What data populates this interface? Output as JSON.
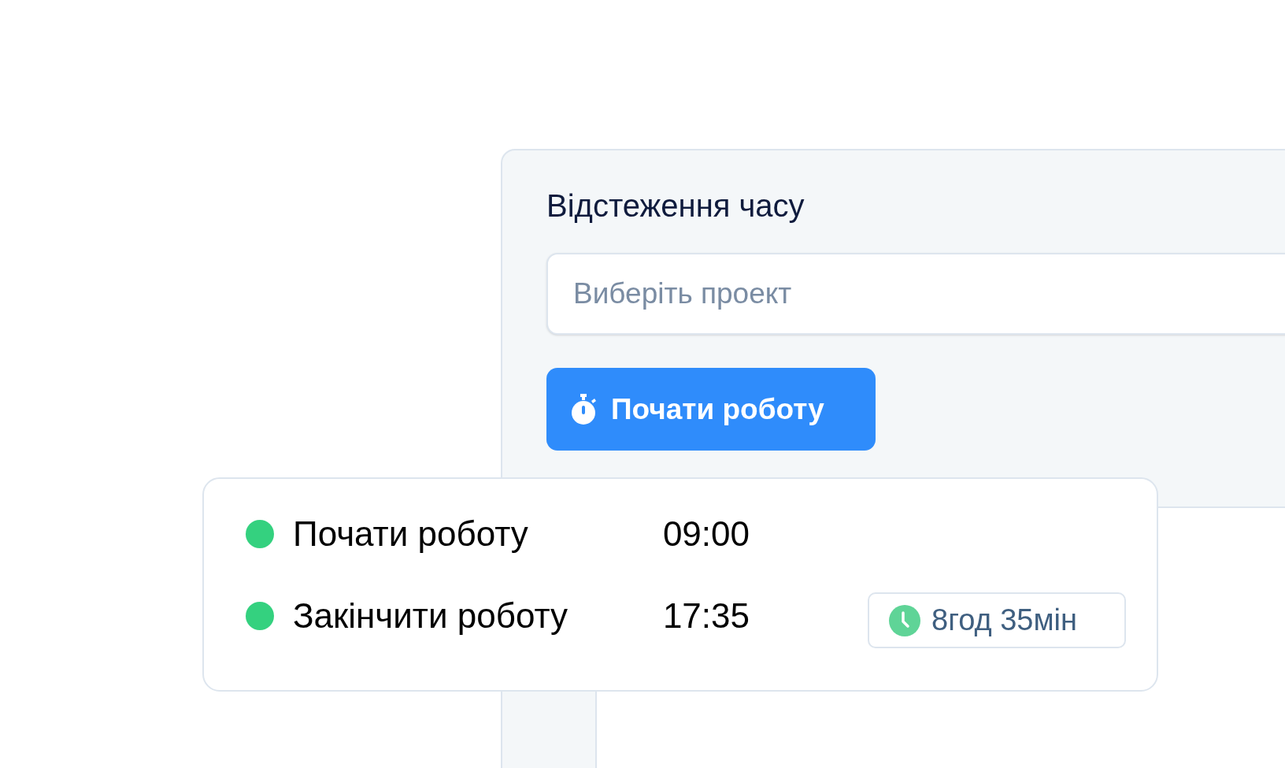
{
  "panel": {
    "title": "Відстеження часу",
    "project_field": {
      "placeholder": "Виберіть проект"
    },
    "start_button": {
      "label": "Почати роботу"
    }
  },
  "popup": {
    "entries": [
      {
        "label": "Почати роботу",
        "time": "09:00",
        "color": "#34d17f"
      },
      {
        "label": "Закінчити роботу",
        "time": "17:35",
        "color": "#34d17f"
      }
    ],
    "total_badge": {
      "text": "8год 35мін"
    }
  }
}
